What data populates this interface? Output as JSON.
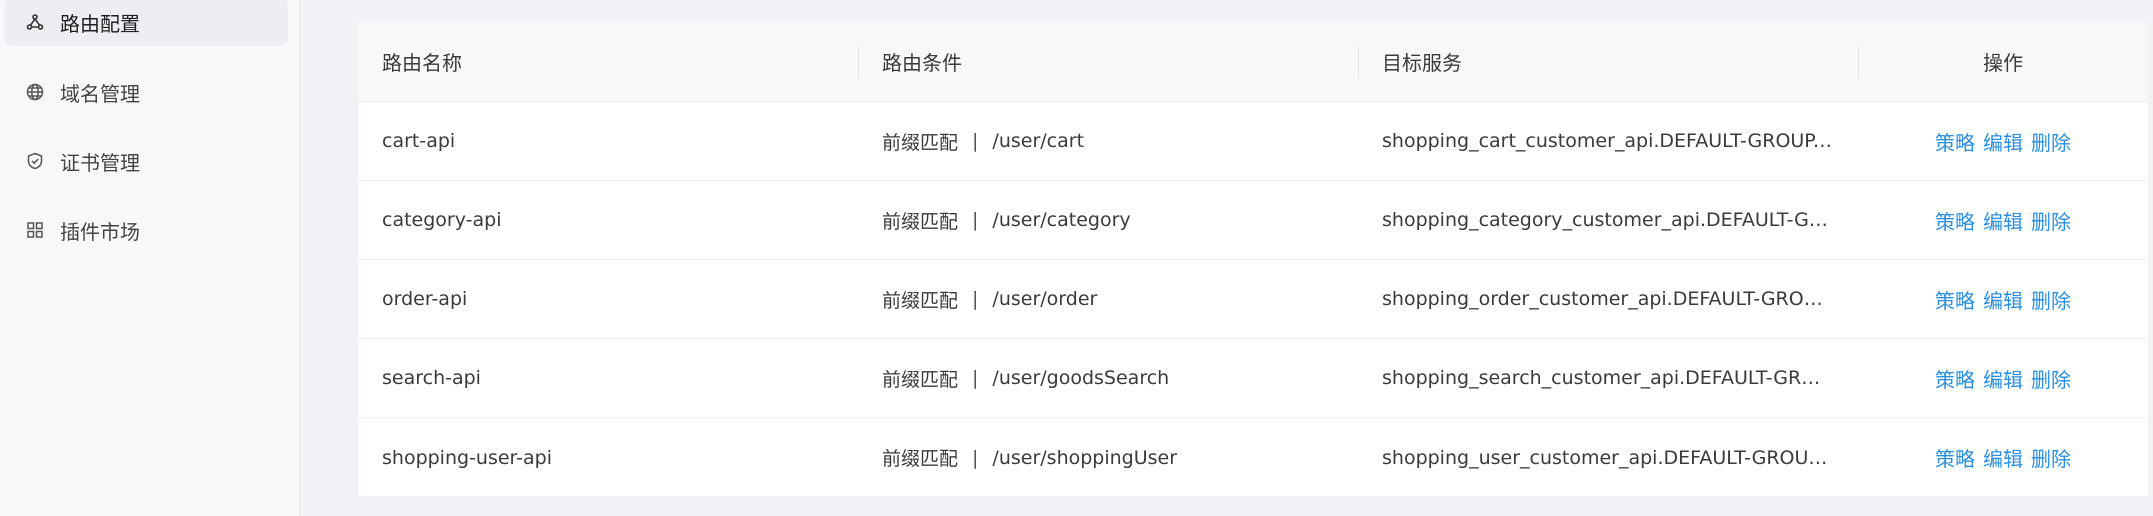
{
  "sidebar": {
    "items": [
      {
        "label": "路由配置",
        "icon": "share-nodes-icon",
        "active": true
      },
      {
        "label": "域名管理",
        "icon": "globe-icon",
        "active": false
      },
      {
        "label": "证书管理",
        "icon": "shield-check-icon",
        "active": false
      },
      {
        "label": "插件市场",
        "icon": "grid-icon",
        "active": false
      }
    ]
  },
  "table": {
    "headers": [
      "路由名称",
      "路由条件",
      "目标服务",
      "操作"
    ],
    "rows": [
      {
        "name": "cart-api",
        "match_type": "前缀匹配",
        "separator": "|",
        "path": "/user/cart",
        "service": "shopping_cart_customer_api.DEFAULT-GROUP.pu...",
        "actions": [
          "策略",
          "编辑",
          "删除"
        ]
      },
      {
        "name": "category-api",
        "match_type": "前缀匹配",
        "separator": "|",
        "path": "/user/category",
        "service": "shopping_category_customer_api.DEFAULT-GRO...",
        "actions": [
          "策略",
          "编辑",
          "删除"
        ]
      },
      {
        "name": "order-api",
        "match_type": "前缀匹配",
        "separator": "|",
        "path": "/user/order",
        "service": "shopping_order_customer_api.DEFAULT-GROUP....",
        "actions": [
          "策略",
          "编辑",
          "删除"
        ]
      },
      {
        "name": "search-api",
        "match_type": "前缀匹配",
        "separator": "|",
        "path": "/user/goodsSearch",
        "service": "shopping_search_customer_api.DEFAULT-GROUP....",
        "actions": [
          "策略",
          "编辑",
          "删除"
        ]
      },
      {
        "name": "shopping-user-api",
        "match_type": "前缀匹配",
        "separator": "|",
        "path": "/user/shoppingUser",
        "service": "shopping_user_customer_api.DEFAULT-GROUP.p...",
        "actions": [
          "策略",
          "编辑",
          "删除"
        ]
      }
    ]
  },
  "colors": {
    "accent": "#2b8fe0",
    "sidebar_bg": "#f7f8fa",
    "active_bg": "#eceef2"
  }
}
